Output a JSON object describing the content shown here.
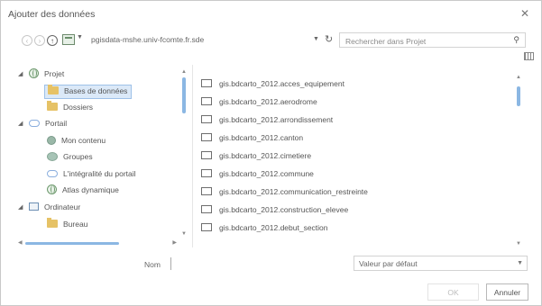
{
  "dialog": {
    "title": "Ajouter des données"
  },
  "toolbar": {
    "path": "pgisdata-mshe.univ-fcomte.fr.sde",
    "search_placeholder": "Rechercher dans Projet"
  },
  "tree": {
    "items": [
      {
        "label": "Projet",
        "icon": "globe-icon",
        "level": 0,
        "expander": "◢"
      },
      {
        "label": "Bases de données",
        "icon": "folder-icon",
        "level": 1,
        "selected": true
      },
      {
        "label": "Dossiers",
        "icon": "folder-icon",
        "level": 1
      },
      {
        "label": "Portail",
        "icon": "cloud-icon",
        "level": 0,
        "expander": "◢"
      },
      {
        "label": "Mon contenu",
        "icon": "person-icon",
        "level": 1
      },
      {
        "label": "Groupes",
        "icon": "group-icon",
        "level": 1
      },
      {
        "label": "L'intégralité du portail",
        "icon": "cloud-icon",
        "level": 1
      },
      {
        "label": "Atlas dynamique",
        "icon": "globe-icon",
        "level": 1
      },
      {
        "label": "Ordinateur",
        "icon": "computer-icon",
        "level": 0,
        "expander": "◢"
      },
      {
        "label": "Bureau",
        "icon": "folder-icon",
        "level": 1
      }
    ]
  },
  "list": {
    "items": [
      "gis.bdcarto_2012.acces_equipement",
      "gis.bdcarto_2012.aerodrome",
      "gis.bdcarto_2012.arrondissement",
      "gis.bdcarto_2012.canton",
      "gis.bdcarto_2012.cimetiere",
      "gis.bdcarto_2012.commune",
      "gis.bdcarto_2012.communication_restreinte",
      "gis.bdcarto_2012.construction_elevee",
      "gis.bdcarto_2012.debut_section"
    ]
  },
  "footer": {
    "name_label": "Nom",
    "name_value": "",
    "filter_value": "Valeur par défaut",
    "ok_label": "OK",
    "cancel_label": "Annuler"
  },
  "colors": {
    "selection": "#dbe9f8",
    "scroll_thumb": "#8bb7e3",
    "folder": "#e6c266"
  }
}
